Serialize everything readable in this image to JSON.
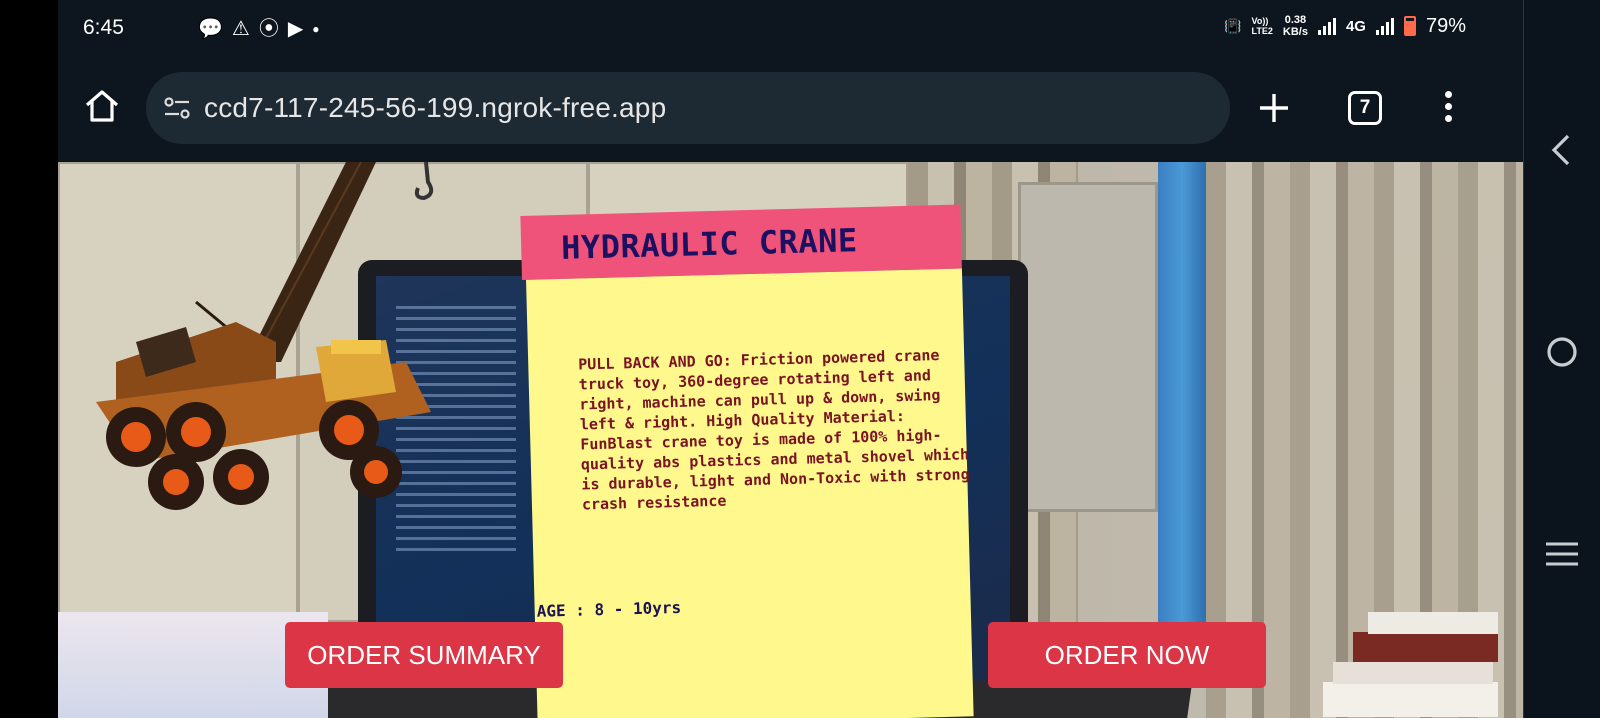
{
  "status_bar": {
    "time": "6:45",
    "notification_icons": [
      "message-icon",
      "alert-icon",
      "compass-icon",
      "youtube-icon",
      "dot-icon"
    ],
    "volte": "Vo))\nLTE2",
    "speed_value": "0.38",
    "speed_unit": "KB/s",
    "network": "4G",
    "battery": "79%"
  },
  "browser": {
    "url": "ccd7-117-245-56-199.ngrok-free.app",
    "tab_count": "7"
  },
  "product": {
    "title": "HYDRAULIC CRANE",
    "description": "PULL BACK AND GO: Friction powered crane truck toy, 360-degree rotating left and right, machine can pull up & down, swing left & right. High Quality Material: FunBlast crane toy is made of 100% high-quality abs plastics and metal shovel which is durable, light and Non-Toxic with strong crash resistance",
    "age": "AGE : 8 - 10yrs"
  },
  "buttons": {
    "order_summary": "ORDER SUMMARY",
    "order_now": "ORDER NOW"
  },
  "colors": {
    "button": "#dc3545",
    "card_header": "#f0537a",
    "card_body": "#fef88d",
    "title_text": "#1c1060",
    "desc_text": "#7a1322"
  }
}
